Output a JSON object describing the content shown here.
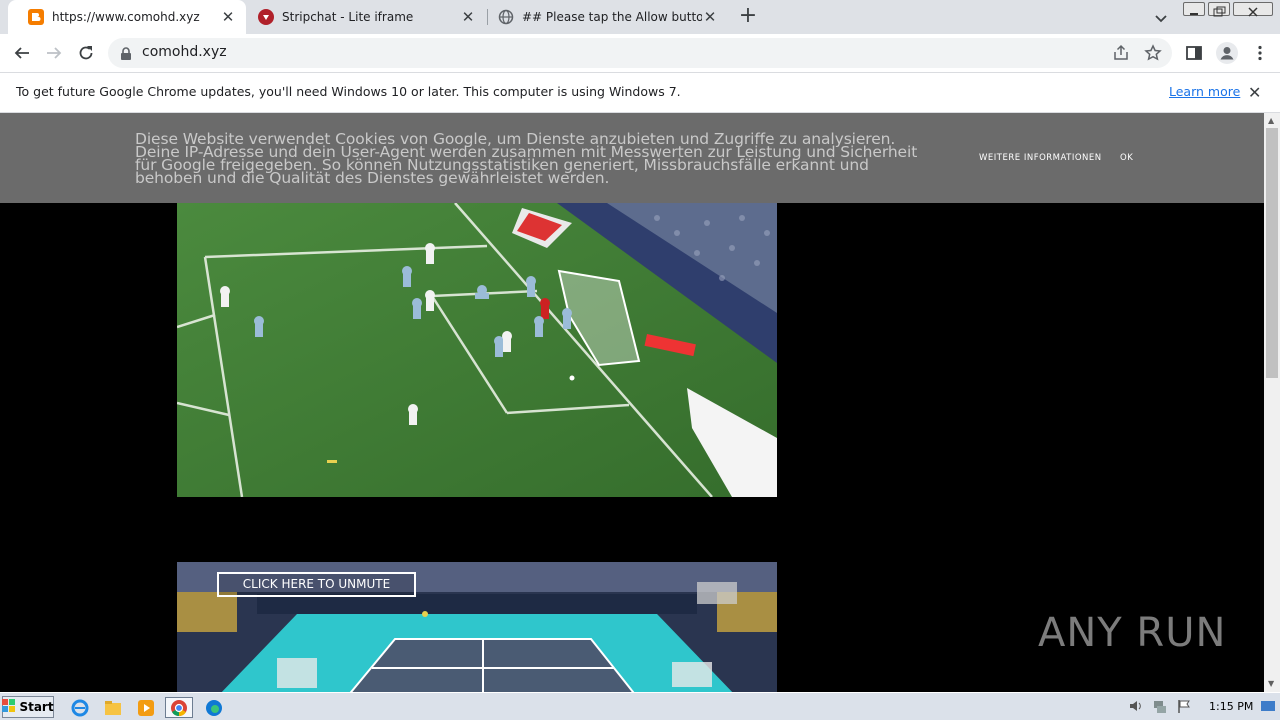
{
  "tabs": [
    {
      "title": "https://www.comohd.xyz",
      "active": true,
      "favicon": "blogger-icon"
    },
    {
      "title": "Stripchat - Lite iframe",
      "active": false,
      "favicon": "stripchat-icon"
    },
    {
      "title": "## Please tap the Allow button to c",
      "active": false,
      "favicon": "globe-icon"
    }
  ],
  "toolbar": {
    "url": "comohd.xyz"
  },
  "infobar": {
    "message": "To get future Google Chrome updates, you'll need Windows 10 or later. This computer is using Windows 7.",
    "learn_more": "Learn more"
  },
  "cookie": {
    "text": "Diese Website verwendet Cookies von Google, um Dienste anzubieten und Zugriffe zu analysieren. Deine IP-Adresse und dein User-Agent werden zusammen mit Messwerten zur Leistung und Sicherheit für Google freigegeben. So können Nutzungsstatistiken generiert, Missbrauchsfälle erkannt und behoben und die Qualität des Dienstes gewährleistet werden.",
    "more_label": "WEITERE INFORMATIONEN",
    "ok_label": "OK"
  },
  "video2": {
    "unmute_label": "CLICK HERE TO UNMUTE"
  },
  "watermark": "ANY RUN",
  "taskbar": {
    "start_label": "Start",
    "clock": "1:15 PM"
  },
  "colors": {
    "tabstrip": "#dee1e6",
    "cookie_bg": "#6b6b6b",
    "link": "#1a73e8"
  }
}
